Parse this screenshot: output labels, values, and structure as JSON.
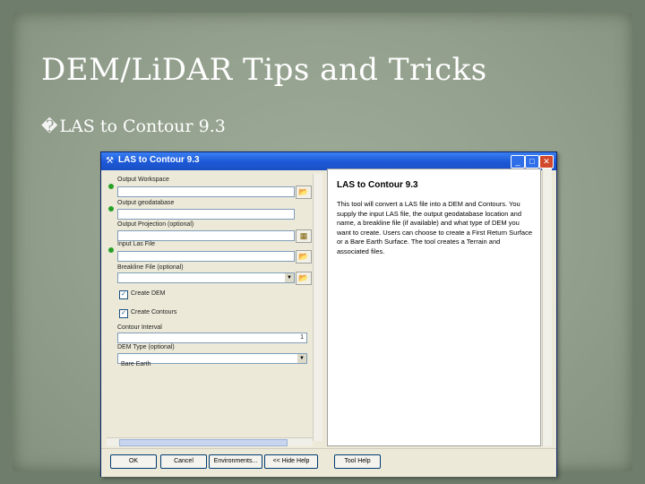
{
  "slide": {
    "title": "DEM/LiDAR Tips and Tricks",
    "bullet_mark": "�",
    "bullet": "LAS to Contour 9.3"
  },
  "dialog": {
    "window_title": "LAS to Contour 9.3",
    "window_icon": "tool-icon",
    "controls": {
      "minimize": "_",
      "maximize": "□",
      "close": "✕"
    },
    "params": [
      {
        "label": "Output Workspace",
        "required": true,
        "value": "",
        "button": "folder-icon"
      },
      {
        "label": "Output geodatabase",
        "required": true,
        "value": ""
      },
      {
        "label": "Output Projection (optional)",
        "required": false,
        "value": "",
        "button": "projection-icon"
      },
      {
        "label": "Input Las File",
        "required": true,
        "value": "",
        "button": "folder-icon"
      },
      {
        "label": "Breakline File (optional)",
        "required": false,
        "value": "",
        "button": "folder-icon",
        "combo": true
      }
    ],
    "checkboxes": [
      {
        "label": "Create DEM",
        "checked": true
      },
      {
        "label": "Create Contours",
        "checked": true
      }
    ],
    "contour_interval": {
      "label": "Contour Interval",
      "value": "1"
    },
    "dem_type": {
      "label": "DEM Type (optional)",
      "value": "Bare Earth"
    },
    "help": {
      "title": "LAS to Contour 9.3",
      "body": "This tool will convert a LAS file into a DEM and Contours. You supply the input LAS file, the output geodatabase location and name, a breakline file (if available) and what type of DEM you want to create. Users can choose to create a First Return Surface or a Bare Earth Surface. The tool creates a Terrain and associated files."
    },
    "buttons": [
      "OK",
      "Cancel",
      "Environments...",
      "<< Hide Help",
      "Tool Help"
    ]
  },
  "colors": {
    "background": "#6f7d6c",
    "slide": "#93a08d",
    "titlebar": "#1d5ad8",
    "dialog": "#ece9d8",
    "required_dot": "#28a028"
  }
}
